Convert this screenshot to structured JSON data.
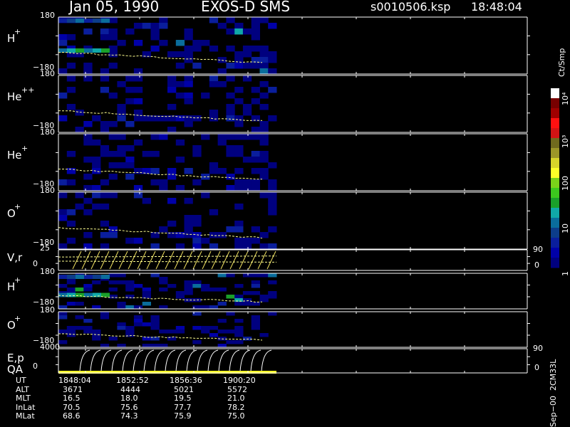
{
  "header": {
    "date": "Jan 05, 1990",
    "instrument": "EXOS-D SMS",
    "file": "s0010506.ksp",
    "time": "18:48:04"
  },
  "colorbar": {
    "unit_label": "Ct/Smp",
    "ticks": [
      {
        "label": "1",
        "value": 1
      },
      {
        "label": "10",
        "value": 10
      },
      {
        "label": "100",
        "value": 100
      },
      {
        "label": "10³",
        "value": 1000
      },
      {
        "label": "10⁴",
        "value": 10000
      }
    ],
    "colors": [
      "#00007f",
      "#0000a8",
      "#0a1e9c",
      "#0c3d8a",
      "#0a6d9c",
      "#10a8a8",
      "#1aa02a",
      "#3cc81e",
      "#7ad21a",
      "#ffff28",
      "#d8d42a",
      "#9c9628",
      "#706a1e",
      "#d21414",
      "#ff1010",
      "#a00000",
      "#780000",
      "#ffffff"
    ]
  },
  "panels": [
    {
      "name": "h-plus-pitch",
      "label": "H",
      "sup": "+",
      "ytop": "180",
      "ybot": "−180"
    },
    {
      "name": "he-plus-plus-pitch",
      "label": "He",
      "sup": "++",
      "ytop": "180",
      "ybot": "−180"
    },
    {
      "name": "he-plus-pitch",
      "label": "He",
      "sup": "+",
      "ytop": "180",
      "ybot": "−180"
    },
    {
      "name": "o-plus-pitch",
      "label": "O",
      "sup": "+",
      "ytop": "180",
      "ybot": "−180"
    },
    {
      "name": "v-r-trace",
      "label": "V,r",
      "sup": "",
      "ytop": "25",
      "ybot": "0",
      "rtop": "90",
      "rbot": "0"
    },
    {
      "name": "h-plus-pitch-2",
      "label": "H",
      "sup": "+",
      "ytop": "180",
      "ybot": "−180"
    },
    {
      "name": "o-plus-pitch-2",
      "label": "O",
      "sup": "+",
      "ytop": "180",
      "ybot": "−180"
    },
    {
      "name": "e-p-qa-trace",
      "label": "E,p",
      "label2": "QA",
      "sup": "",
      "ytop": "4000",
      "ybot": "0",
      "rtop": "90",
      "rbot": "0"
    }
  ],
  "footer": {
    "rows": [
      {
        "label": "UT",
        "values": [
          "1848:04",
          "1852:52",
          "1856:36",
          "1900:20"
        ]
      },
      {
        "label": "ALT",
        "values": [
          "3671",
          "4444",
          "5021",
          "5572"
        ]
      },
      {
        "label": "MLT",
        "values": [
          "16.5",
          "18.0",
          "19.5",
          "21.0"
        ]
      },
      {
        "label": "InLat",
        "values": [
          "70.5",
          "75.6",
          "77.7",
          "78.2"
        ]
      },
      {
        "label": "MLat",
        "values": [
          "68.6",
          "74.3",
          "75.9",
          "75.0"
        ]
      }
    ],
    "note": "Sep−00  2CM33L"
  },
  "chart_data": {
    "type": "heatmap",
    "title": "Jan 05, 1990   EXOS-D SMS",
    "x_ticks": [
      "1848:04",
      "1852:52",
      "1856:36",
      "1900:20"
    ],
    "colorbar_label": "Ct/Smp",
    "colorbar_ticks": [
      "1",
      "10",
      "100",
      "10³",
      "10⁴"
    ],
    "series": [
      {
        "name": "H+",
        "ylim": [
          -180,
          180
        ]
      },
      {
        "name": "He++",
        "ylim": [
          -180,
          180
        ]
      },
      {
        "name": "He+",
        "ylim": [
          -180,
          180
        ]
      },
      {
        "name": "O+",
        "ylim": [
          -180,
          180
        ]
      },
      {
        "name": "V,r",
        "ylim": [
          0,
          25
        ],
        "y2lim": [
          0,
          90
        ]
      },
      {
        "name": "H+",
        "ylim": [
          -180,
          180
        ]
      },
      {
        "name": "O+",
        "ylim": [
          -180,
          180
        ]
      },
      {
        "name": "E,p",
        "ylim": [
          0,
          4000
        ],
        "y2lim": [
          0,
          90
        ]
      }
    ]
  }
}
